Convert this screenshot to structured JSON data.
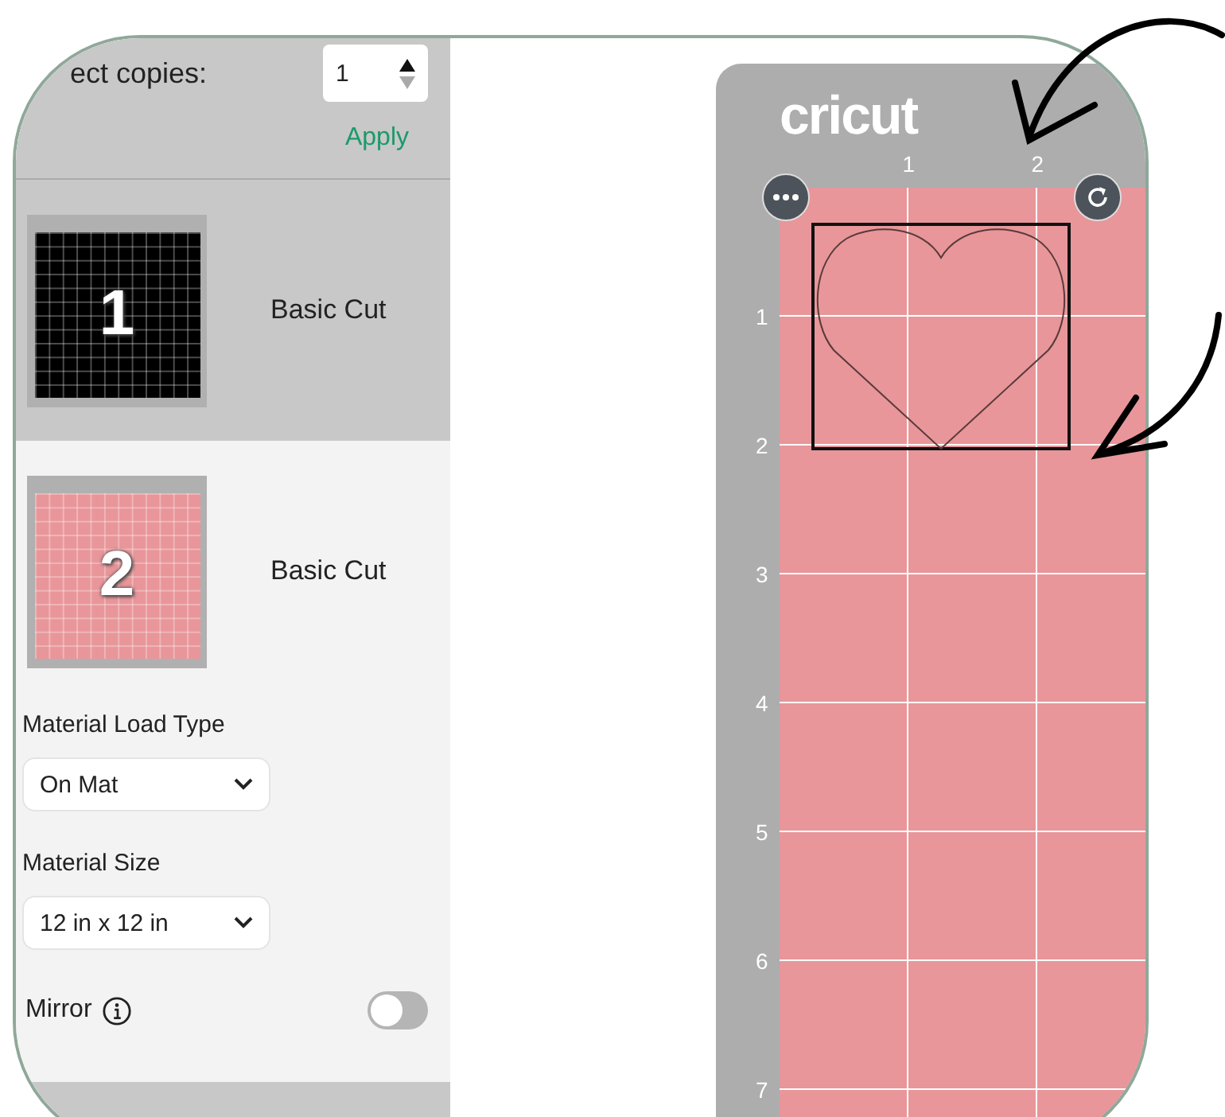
{
  "copies": {
    "label": "ect copies:",
    "value": "1"
  },
  "apply": "Apply",
  "mats": [
    {
      "number": "1",
      "color": "#000000",
      "label": "Basic Cut",
      "selected": false
    },
    {
      "number": "2",
      "color": "#e8969a",
      "label": "Basic Cut",
      "selected": true
    }
  ],
  "fields": [
    {
      "label": "Material Load Type",
      "value": "On Mat"
    },
    {
      "label": "Material Size",
      "value": "12 in x 12 in"
    }
  ],
  "mirror": {
    "label": "Mirror",
    "on": false
  },
  "preview": {
    "logo": "cricut",
    "color": "#e8969a",
    "top_ruler": [
      "1",
      "2"
    ],
    "side_ruler": [
      "1",
      "2",
      "3",
      "4",
      "5",
      "6",
      "7"
    ]
  }
}
